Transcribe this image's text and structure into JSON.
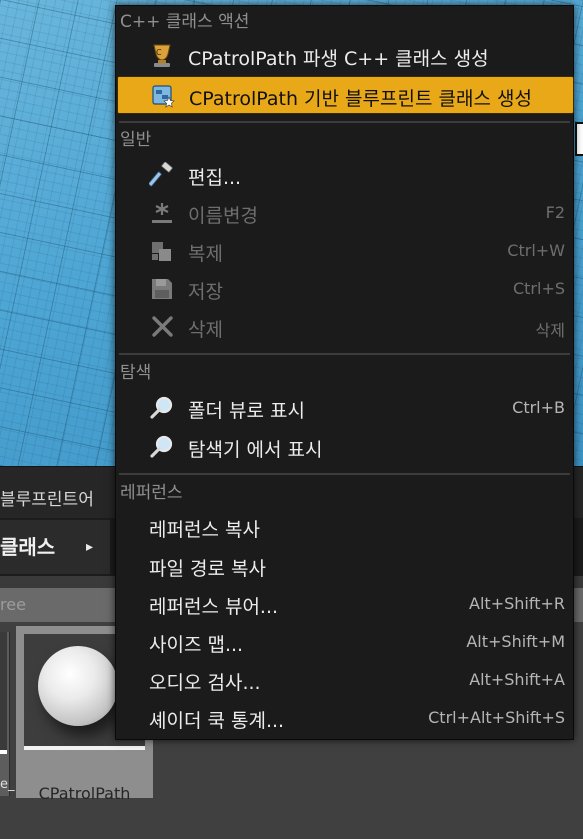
{
  "colors": {
    "menu_bg": "#1b1b1b",
    "highlight": "#e8a818",
    "viewport_floor": "#4ea6d4"
  },
  "content_browser": {
    "title_fragment": "블루프린트어",
    "folder_label": "클래스",
    "folder_arrow": "▸",
    "filter_hint": "ree",
    "left_tile_label": "e_",
    "asset_name": "CPatrolPath"
  },
  "context_menu": {
    "sections": {
      "cpp": "C++ 클래스 액션",
      "general": "일반",
      "explore": "탐색",
      "references": "레퍼런스"
    },
    "items": {
      "create_cpp_class": {
        "label": "CPatrolPath 파생 C++ 클래스 생성",
        "icon": "cpp-class-icon"
      },
      "create_blueprint_class": {
        "label": "CPatrolPath 기반 블루프린트 클래스 생성",
        "icon": "blueprint-class-icon"
      },
      "edit": {
        "label": "편집...",
        "icon": "hammer-icon"
      },
      "rename": {
        "label": "이름변경",
        "shortcut": "F2",
        "icon": "rename-icon"
      },
      "duplicate": {
        "label": "복제",
        "shortcut": "Ctrl+W",
        "icon": "duplicate-icon"
      },
      "save": {
        "label": "저장",
        "shortcut": "Ctrl+S",
        "icon": "save-icon"
      },
      "delete": {
        "label": "삭제",
        "shortcut": "삭제",
        "icon": "delete-icon"
      },
      "show_in_folder_view": {
        "label": "폴더 뷰로 표시",
        "shortcut": "Ctrl+B",
        "icon": "magnifier-icon"
      },
      "show_in_explorer": {
        "label": "탐색기 에서 표시",
        "icon": "magnifier-icon"
      },
      "copy_reference": {
        "label": "레퍼런스 복사"
      },
      "copy_file_path": {
        "label": "파일 경로 복사"
      },
      "reference_viewer": {
        "label": "레퍼런스 뷰어...",
        "shortcut": "Alt+Shift+R"
      },
      "size_map": {
        "label": "사이즈 맵...",
        "shortcut": "Alt+Shift+M"
      },
      "audit": {
        "label": "오디오 검사...",
        "shortcut": "Alt+Shift+A"
      },
      "shader_cook_stats": {
        "label": "셰이더 쿡 통계...",
        "shortcut": "Ctrl+Alt+Shift+S"
      }
    }
  }
}
